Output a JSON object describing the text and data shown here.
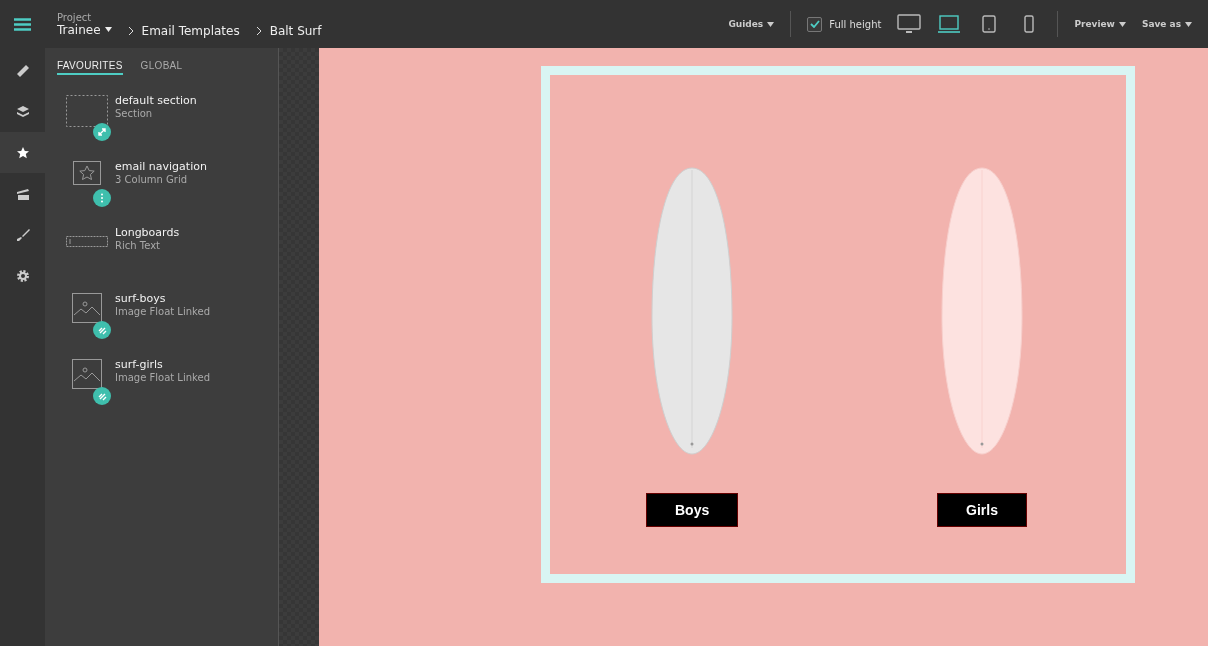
{
  "topbar": {
    "project_label": "Project",
    "project": "Trainee",
    "breadcrumbs": [
      "Email Templates",
      "Balt Surf"
    ],
    "guides": "Guides",
    "full_height": {
      "label": "Full height",
      "checked": true
    },
    "devices": [
      {
        "kind": "desktop",
        "selected": false
      },
      {
        "kind": "laptop",
        "selected": true
      },
      {
        "kind": "tablet",
        "selected": false
      },
      {
        "kind": "phone",
        "selected": false
      }
    ],
    "preview": "Preview",
    "save_as": "Save as"
  },
  "rail": [
    {
      "kind": "ruler",
      "selected": false
    },
    {
      "kind": "layers",
      "selected": false
    },
    {
      "kind": "star",
      "selected": true
    },
    {
      "kind": "store",
      "selected": false
    },
    {
      "kind": "brush",
      "selected": false
    },
    {
      "kind": "gear",
      "selected": false
    }
  ],
  "tabs": [
    {
      "label": "FAVOURITES",
      "selected": true
    },
    {
      "label": "GLOBAL",
      "selected": false
    }
  ],
  "items": [
    {
      "title": "default section",
      "subtitle": "Section",
      "thumbnail": {
        "kind": "section"
      },
      "badge": {
        "kind": "expand"
      }
    },
    {
      "title": "email navigation",
      "subtitle": "3 Column Grid",
      "thumbnail": {
        "kind": "star"
      },
      "badge": {
        "kind": "dots"
      }
    },
    {
      "title": "Longboards",
      "subtitle": "Rich Text",
      "thumbnail": {
        "kind": "text"
      }
    },
    {
      "title": "surf-boys",
      "subtitle": "Image Float Linked",
      "thumbnail": {
        "kind": "image"
      },
      "badge": {
        "kind": "link"
      }
    },
    {
      "title": "surf-girls",
      "subtitle": "Image Float Linked",
      "thumbnail": {
        "kind": "image"
      },
      "badge": {
        "kind": "link"
      }
    }
  ],
  "canvas": {
    "products": [
      {
        "label": "Boys",
        "board": {
          "kind": "white"
        }
      },
      {
        "label": "Girls",
        "board": {
          "kind": "pink"
        }
      }
    ]
  }
}
